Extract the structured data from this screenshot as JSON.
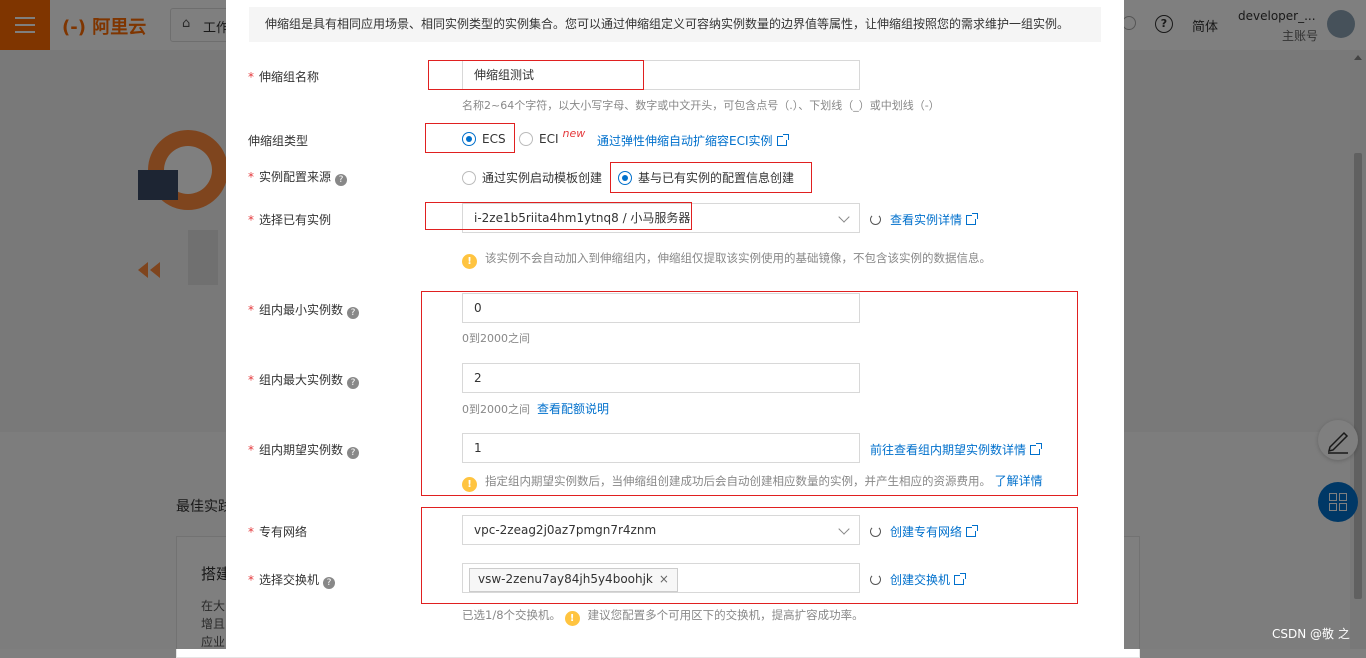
{
  "header": {
    "logo": "阿里云",
    "workbench": "工作",
    "lang": "简体",
    "user_name": "developer_...",
    "user_role": "主账号"
  },
  "background": {
    "section_heading": "最佳实践",
    "card_title": "搭建",
    "card_lines": [
      "在大",
      "增且",
      "应业"
    ]
  },
  "watermark": "CSDN @敬 之",
  "modal": {
    "intro": "伸缩组是具有相同应用场景、相同实例类型的实例集合。您可以通过伸缩组定义可容纳实例数量的边界值等属性，让伸缩组按照您的需求维护一组实例。",
    "group_name": {
      "label": "伸缩组名称",
      "value": "伸缩组测试",
      "hint": "名称2~64个字符，以大小写字母、数字或中文开头，可包含点号（.）、下划线（_）或中划线（-）"
    },
    "group_type": {
      "label": "伸缩组类型",
      "opt_ecs": "ECS",
      "opt_eci": "ECI",
      "new_tag": "new",
      "link": "通过弹性伸缩自动扩缩容ECI实例"
    },
    "instance_source": {
      "label": "实例配置来源",
      "opt_template": "通过实例启动模板创建",
      "opt_existing": "基与已有实例的配置信息创建"
    },
    "select_instance": {
      "label": "选择已有实例",
      "value": "i-2ze1b5riita4hm1ytnq8 / 小马服务器",
      "link": "查看实例详情",
      "warn": "该实例不会自动加入到伸缩组内，伸缩组仅提取该实例使用的基础镜像，不包含该实例的数据信息。"
    },
    "min_instances": {
      "label": "组内最小实例数",
      "value": "0",
      "hint": "0到2000之间"
    },
    "max_instances": {
      "label": "组内最大实例数",
      "value": "2",
      "hint": "0到2000之间",
      "link": "查看配额说明"
    },
    "desired_instances": {
      "label": "组内期望实例数",
      "value": "1",
      "link": "前往查看组内期望实例数详情",
      "warn": "指定组内期望实例数后，当伸缩组创建成功后会自动创建相应数量的实例，并产生相应的资源费用。",
      "warn_link": "了解详情"
    },
    "vpc": {
      "label": "专有网络",
      "value": "vpc-2zeag2j0az7pmgn7r4znm",
      "link": "创建专有网络"
    },
    "vswitch": {
      "label": "选择交换机",
      "tag": "vsw-2zenu7ay84jh5y4boohjk",
      "tag_close": "×",
      "link": "创建交换机",
      "hint": "已选1/8个交换机。",
      "warn": "建议您配置多个可用区下的交换机，提高扩容成功率。"
    }
  }
}
